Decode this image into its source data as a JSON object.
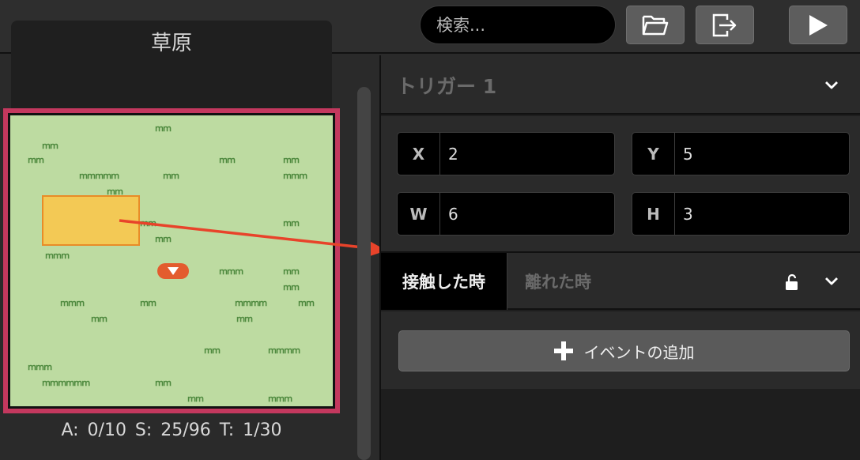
{
  "toolbar": {
    "search_placeholder": "検索...",
    "icons": [
      "folder-open-icon",
      "export-icon",
      "play-icon"
    ]
  },
  "map": {
    "title": "草原",
    "stats": "A: 0/10   S: 25/96   T: 1/30",
    "colors": {
      "grass_bg": "#bddba1",
      "selection_border": "#c3385e",
      "trigger_fill": "#f3c955",
      "trigger_border": "#e88c28",
      "arrow": "#e8432a"
    }
  },
  "inspector": {
    "title": "トリガー 1",
    "fields": {
      "x": {
        "label": "X",
        "value": "2"
      },
      "y": {
        "label": "Y",
        "value": "5"
      },
      "w": {
        "label": "W",
        "value": "6"
      },
      "h": {
        "label": "H",
        "value": "3"
      }
    },
    "tabs": {
      "active": "接触した時",
      "inactive": "離れた時"
    },
    "add_event_label": "イベントの追加"
  }
}
